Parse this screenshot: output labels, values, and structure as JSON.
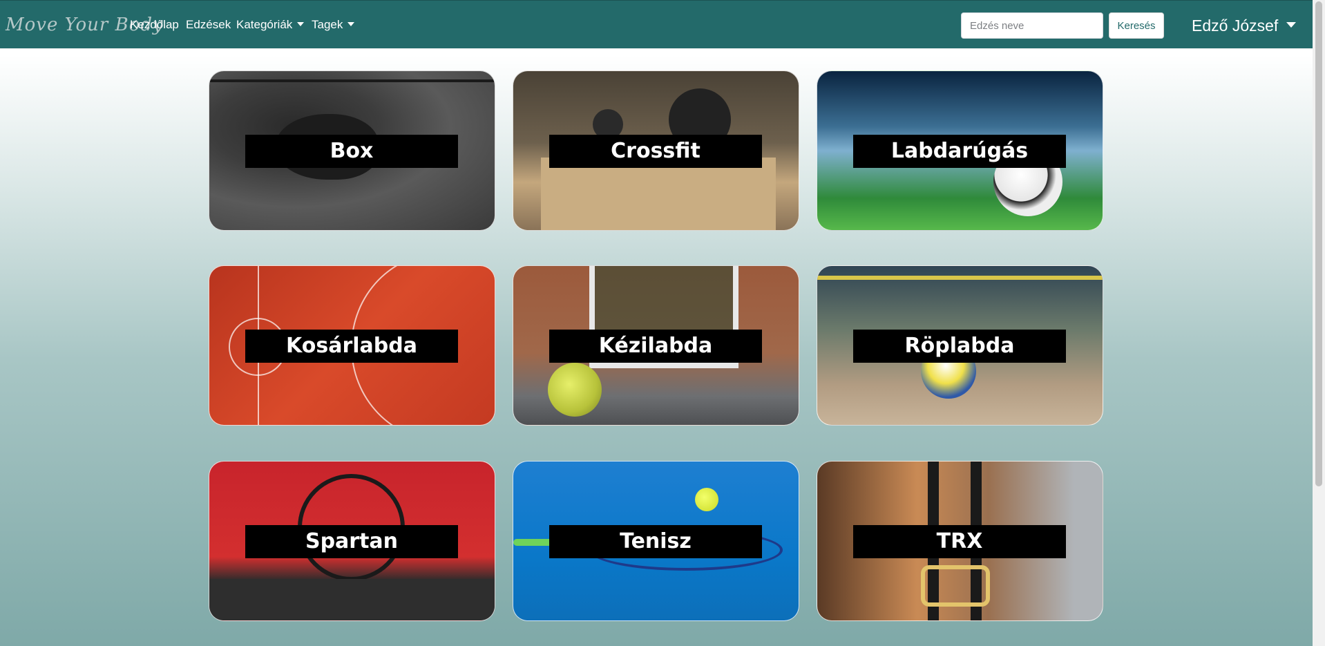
{
  "navbar": {
    "brand": "Move Your Body",
    "links": [
      {
        "label": "Kezdőlap"
      },
      {
        "label": "Edzések"
      },
      {
        "label": "Kategóriák"
      },
      {
        "label": "Tagek"
      }
    ],
    "search": {
      "placeholder": "Edzés neve",
      "value": "",
      "button_label": "Keresés"
    },
    "user": {
      "name": "Edző József"
    }
  },
  "colors": {
    "navbar": "#236a6a",
    "card_label_bg": "#000000",
    "card_label_text": "#ffffff"
  },
  "categories": [
    {
      "label": "Box"
    },
    {
      "label": "Crossfit"
    },
    {
      "label": "Labdarúgás"
    },
    {
      "label": "Kosárlabda"
    },
    {
      "label": "Kézilabda"
    },
    {
      "label": "Röplabda"
    },
    {
      "label": "Spartan"
    },
    {
      "label": "Tenisz"
    },
    {
      "label": "TRX"
    }
  ]
}
